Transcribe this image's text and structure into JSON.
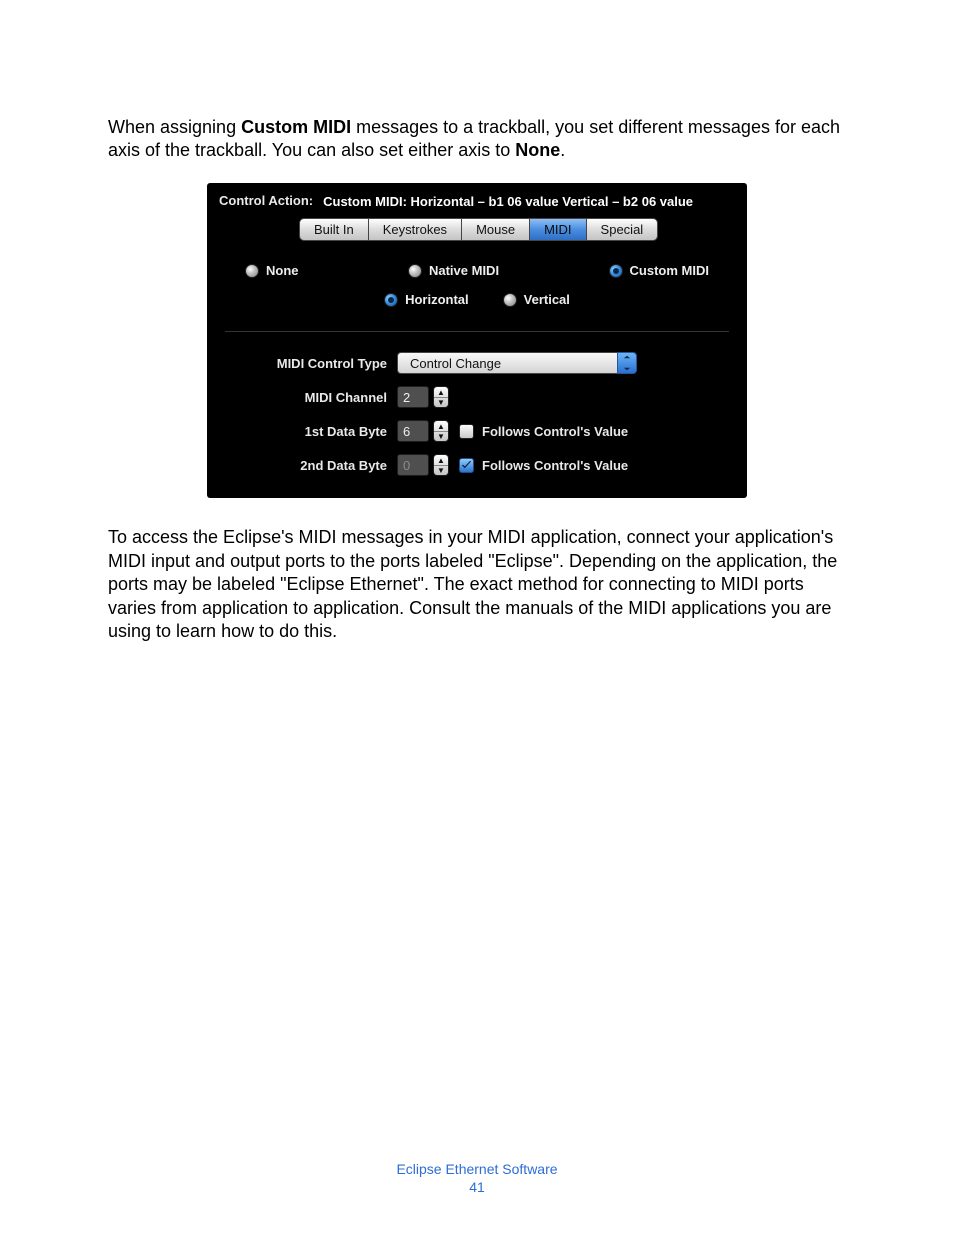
{
  "paragraph1": {
    "pre": "When assigning ",
    "b1": "Custom MIDI",
    "mid": " messages to a trackball, you set different messages for each axis of the trackball. You can also set either axis to ",
    "b2": "None",
    "post": "."
  },
  "panel": {
    "ca_label": "Control Action:",
    "ca_value": "Custom MIDI: Horizontal – b1 06 value Vertical – b2 06 value",
    "tabs": [
      "Built In",
      "Keystrokes",
      "Mouse",
      "MIDI",
      "Special"
    ],
    "tab_selected": 3,
    "mode_radios": [
      "None",
      "Native MIDI",
      "Custom MIDI"
    ],
    "mode_selected": 2,
    "axis_radios": [
      "Horizontal",
      "Vertical"
    ],
    "axis_selected": 0,
    "rows": {
      "type_label": "MIDI Control Type",
      "type_value": "Control Change",
      "channel_label": "MIDI Channel",
      "channel_value": "2",
      "byte1_label": "1st Data Byte",
      "byte1_value": "6",
      "byte1_follow_label": "Follows Control's Value",
      "byte1_follow_checked": false,
      "byte2_label": "2nd Data Byte",
      "byte2_value": "0",
      "byte2_follow_label": "Follows Control's Value",
      "byte2_follow_checked": true
    }
  },
  "paragraph2": "To access the Eclipse's MIDI messages in your MIDI application, connect your application's MIDI input and output ports to the ports labeled \"Eclipse\". Depending on the application, the ports may be labeled \"Eclipse Ethernet\". The exact method for connecting to MIDI ports varies from application to application. Consult the manuals of the MIDI applications you are using to learn how to do this.",
  "footer": {
    "product": "Eclipse Ethernet Software",
    "page": "41"
  }
}
